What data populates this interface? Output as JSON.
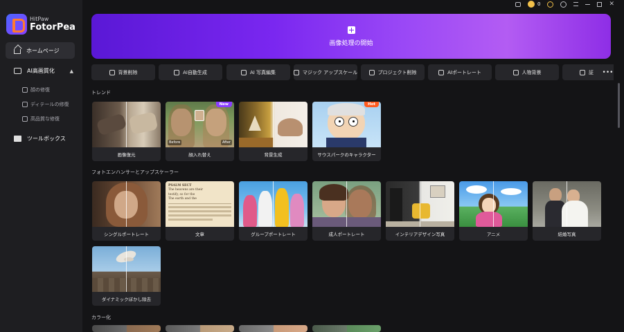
{
  "app": {
    "brand_small": "HitPaw",
    "brand_big": "FotorPea",
    "coins": "0"
  },
  "sidebar": {
    "home": "ホームページ",
    "ai_enhance": "AI高画質化",
    "sub_items": [
      "顔の修復",
      "ディテールの修復",
      "高品質な修復"
    ],
    "toolbox": "ツールボックス"
  },
  "hero": {
    "label": "画像処理の開始"
  },
  "tools": [
    "背景削除",
    "AI自動生成",
    "AI 写真編集",
    "マジック アップスケール",
    "プロジェクト削除",
    "AIポートレート",
    "人物背景",
    "証"
  ],
  "sections": {
    "trend": "トレンド",
    "enhancer": "フォトエンハンサーとアップスケーラー",
    "colorize": "カラー化"
  },
  "trend_cards": [
    {
      "label": "画像復元"
    },
    {
      "label": "顔入れ替え",
      "badge": "New",
      "before": "Before",
      "after": "After"
    },
    {
      "label": "背景生成"
    },
    {
      "label": "サウスパークのキャラクター",
      "badge": "Hot"
    }
  ],
  "enhancer_cards": [
    {
      "label": "シングルポートレート"
    },
    {
      "label": "文章",
      "text_lines": [
        "PSALM SECT",
        "The heavens are their",
        "testify, so for the",
        "The earth and the"
      ]
    },
    {
      "label": "グループポートレート"
    },
    {
      "label": "成人ポートレート"
    },
    {
      "label": "インテリアデザイン写真"
    },
    {
      "label": "アニメ"
    },
    {
      "label": "結婚写真"
    },
    {
      "label": "ダイナミックぼかし除去"
    }
  ],
  "colors": {
    "accent": "#7a27f0",
    "hot": "#ff5a1f",
    "new": "#8a3dff",
    "sidebar": "#1e1e21",
    "bg": "#141416"
  }
}
